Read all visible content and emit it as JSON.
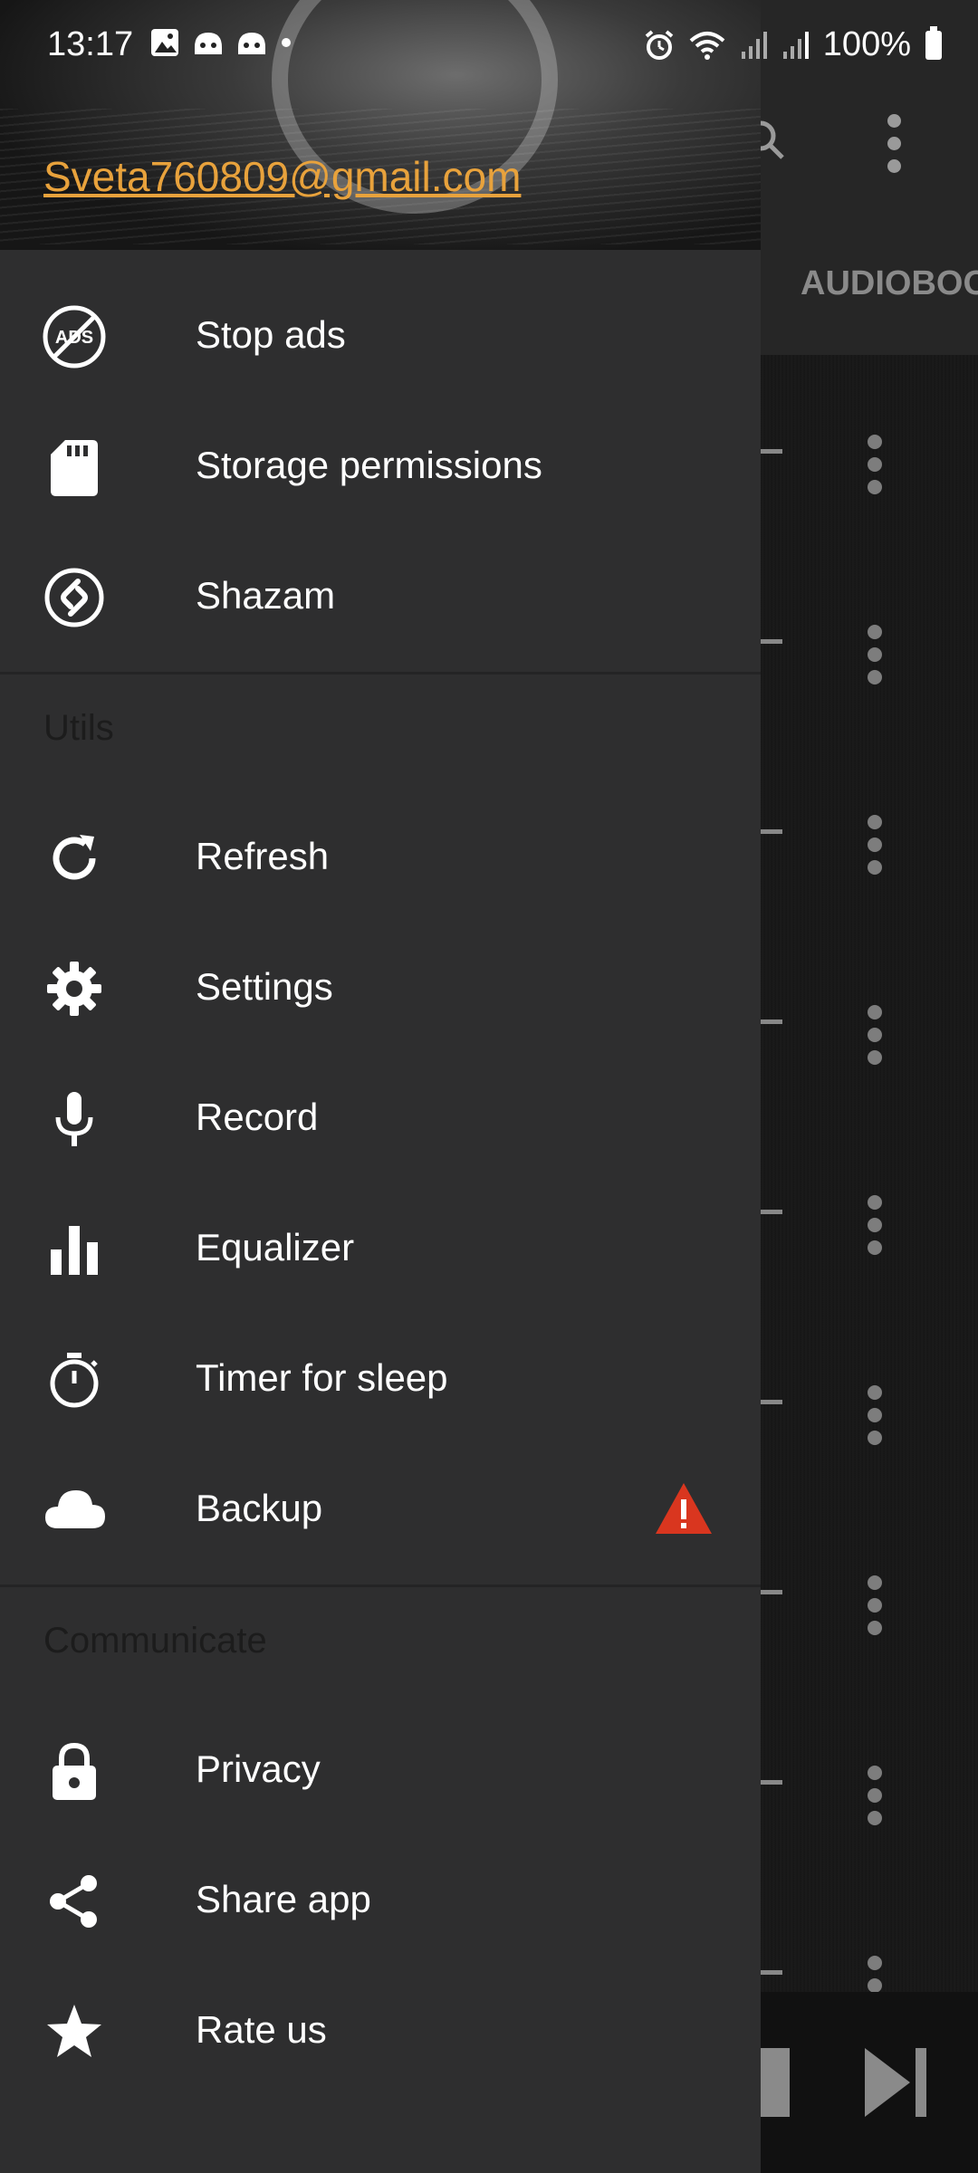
{
  "status_bar": {
    "time": "13:17",
    "battery": "100%",
    "icons": [
      "gallery-icon",
      "app-icon",
      "app-icon",
      "dot-icon",
      "alarm-icon",
      "wifi-icon",
      "signal-icon",
      "signal-icon",
      "battery-icon"
    ]
  },
  "drawer": {
    "account_email": "Sveta760809@gmail.com",
    "sections": [
      {
        "title": "",
        "items": [
          {
            "label": "Stop ads",
            "icon": "no-ads-icon"
          },
          {
            "label": "Storage permissions",
            "icon": "sd-card-icon"
          },
          {
            "label": "Shazam",
            "icon": "shazam-icon"
          }
        ]
      },
      {
        "title": "Utils",
        "items": [
          {
            "label": "Refresh",
            "icon": "refresh-icon"
          },
          {
            "label": "Settings",
            "icon": "gear-icon"
          },
          {
            "label": "Record",
            "icon": "microphone-icon"
          },
          {
            "label": "Equalizer",
            "icon": "equalizer-icon"
          },
          {
            "label": "Timer for sleep",
            "icon": "timer-icon"
          },
          {
            "label": "Backup",
            "icon": "cloud-icon",
            "badge": "warning-icon"
          }
        ]
      },
      {
        "title": "Communicate",
        "items": [
          {
            "label": "Privacy",
            "icon": "lock-icon"
          },
          {
            "label": "Share app",
            "icon": "share-icon"
          },
          {
            "label": "Rate us",
            "icon": "star-icon"
          }
        ]
      }
    ]
  },
  "background": {
    "tab_label": "AUDIOBOO"
  },
  "colors": {
    "drawer_bg": "#2e2e2f",
    "accent_email": "#e8a23c",
    "warning": "#d9361f",
    "section_title": "#1c1c1c"
  }
}
